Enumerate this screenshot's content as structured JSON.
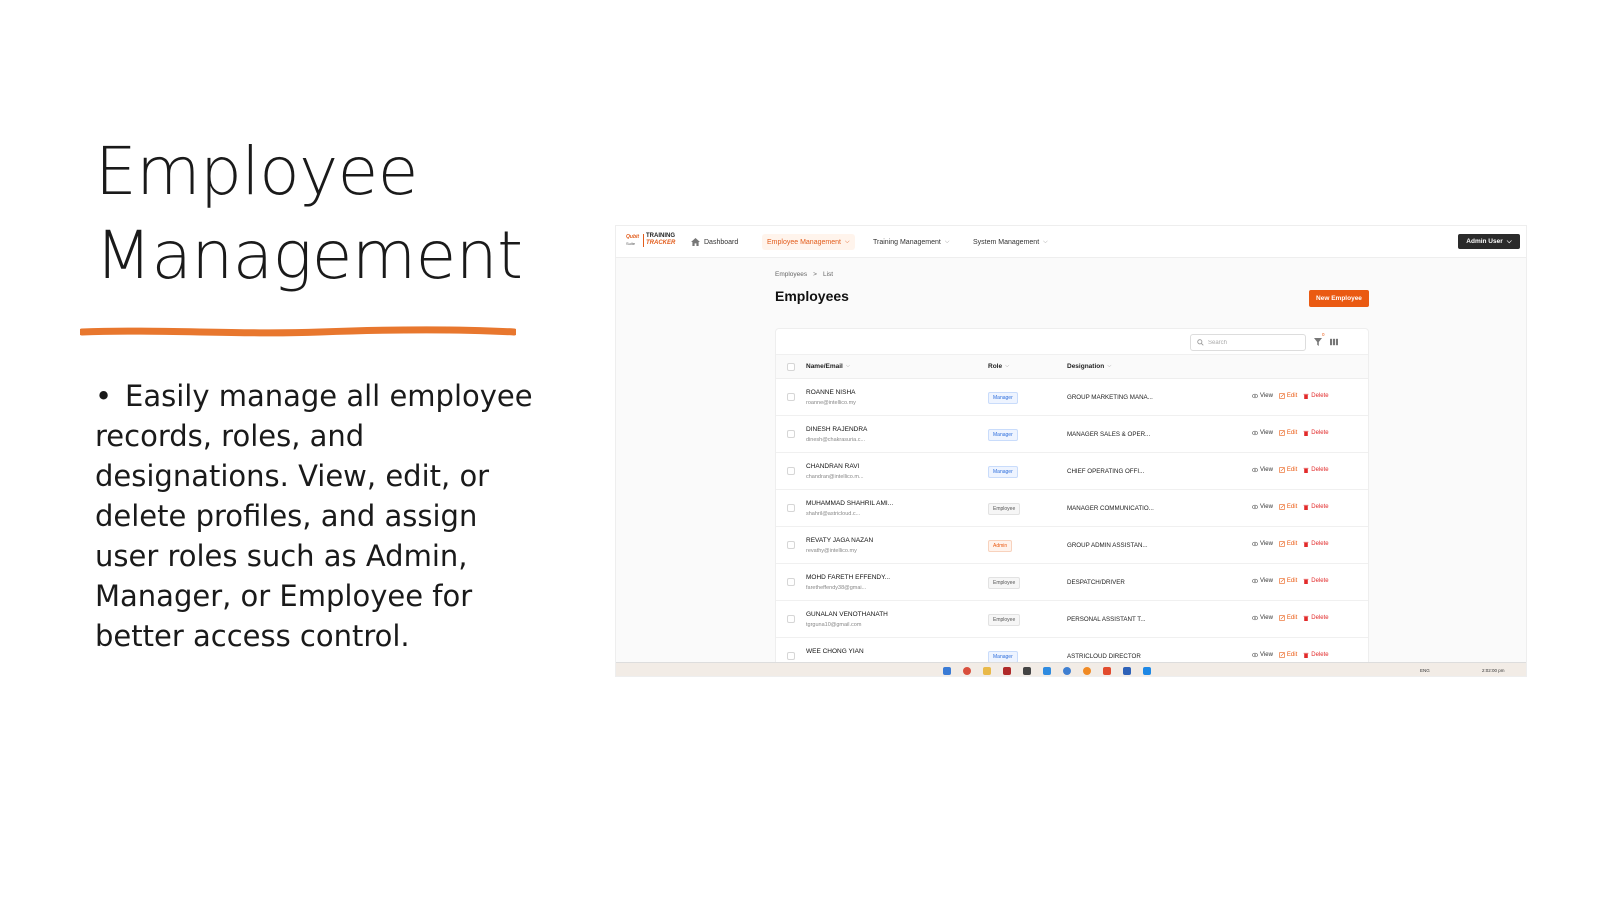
{
  "slide": {
    "title_line1": "Employee",
    "title_line2": "Management",
    "bullet": "Easily manage all employee records, roles, and designations. View, edit, or delete profiles, and assign user roles such as Admin, Manager, or Employee for better access control.",
    "accent_color": "#E8772E"
  },
  "app": {
    "logo": {
      "brand_top": "Qubit",
      "brand_bottom": "Suite",
      "product_top": "TRAINING",
      "product_bottom": "TRACKER"
    },
    "nav": {
      "dashboard": "Dashboard",
      "employee_management": "Employee Management",
      "training_management": "Training Management",
      "system_management": "System Management",
      "user_menu": "Admin User"
    },
    "breadcrumb": {
      "root": "Employees",
      "sep": ">",
      "current": "List"
    },
    "page_title": "Employees",
    "new_button": "New Employee",
    "search_placeholder": "Search",
    "filter_count": "0",
    "columns": {
      "name": "Name/Email",
      "role": "Role",
      "designation": "Designation"
    },
    "actions": {
      "view": "View",
      "edit": "Edit",
      "delete": "Delete"
    },
    "employees": [
      {
        "name": "ROANNE NISHA",
        "email": "roanne@intellico.my",
        "role": "Manager",
        "designation": "GROUP MARKETING MANA..."
      },
      {
        "name": "DINESH RAJENDRA",
        "email": "dinesh@chakrasuria.c...",
        "role": "Manager",
        "designation": "MANAGER SALES & OPER..."
      },
      {
        "name": "CHANDRAN RAVI",
        "email": "chandran@intellico.m...",
        "role": "Manager",
        "designation": "CHIEF OPERATING OFFI..."
      },
      {
        "name": "MUHAMMAD SHAHRIL AMI...",
        "email": "shahril@astricloud.c...",
        "role": "Employee",
        "designation": "MANAGER COMMUNICATIO..."
      },
      {
        "name": "REVATY JAGA NAZAN",
        "email": "revathy@intellico.my",
        "role": "Admin",
        "designation": "GROUP ADMIN ASSISTAN..."
      },
      {
        "name": "MOHD FARETH EFFENDY...",
        "email": "faretheffendy38@gmai...",
        "role": "Employee",
        "designation": "DESPATCH/DRIVER"
      },
      {
        "name": "GUNALAN VENOTHANATH",
        "email": "tgrguna10@gmail.com",
        "role": "Employee",
        "designation": "PERSONAL ASSISTANT T..."
      },
      {
        "name": "WEE CHONG YIAN",
        "email": "",
        "role": "Manager",
        "designation": "ASTRICLOUD DIRECTOR"
      }
    ],
    "taskbar": {
      "lang": "ENG",
      "clock": "2:02:00 pm"
    },
    "colors": {
      "primary": "#EA5A12",
      "dark": "#2B2B2B",
      "manager": "#2F6FDC",
      "delete": "#E22A2A"
    }
  }
}
